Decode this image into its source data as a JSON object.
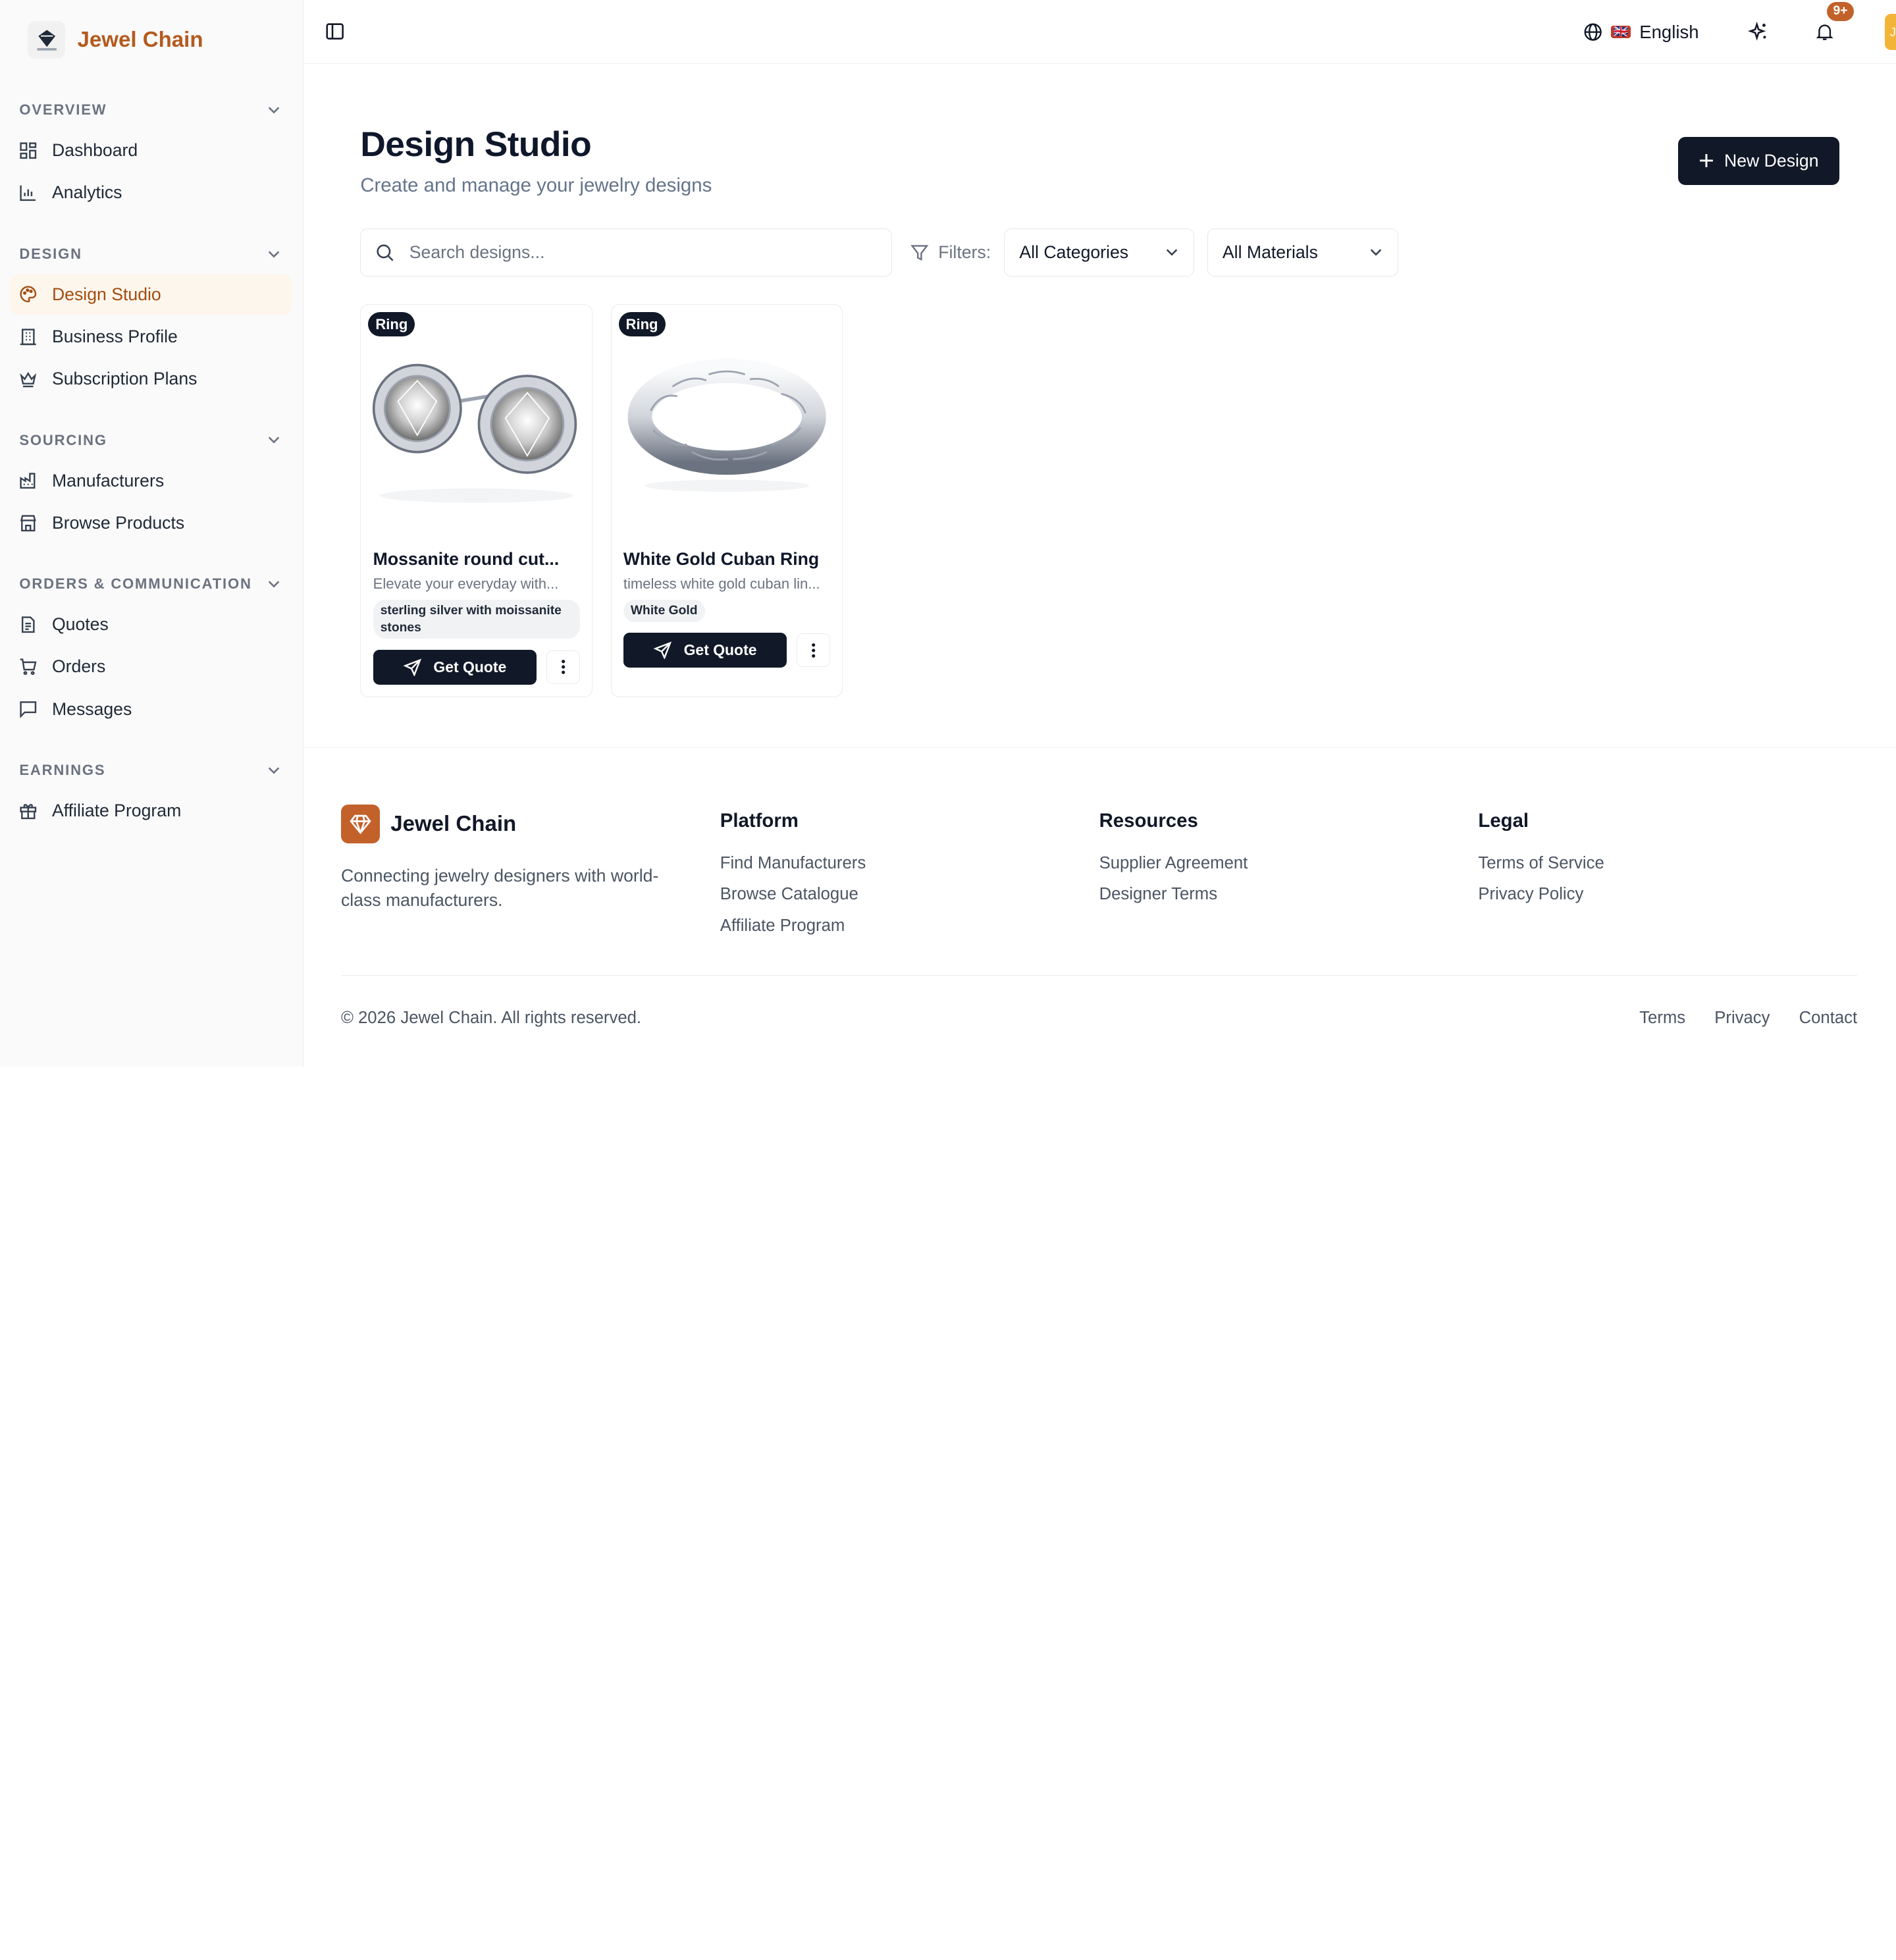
{
  "brand": {
    "name": "Jewel Chain"
  },
  "sidebar": {
    "sections": [
      {
        "title": "OVERVIEW",
        "items": [
          {
            "label": "Dashboard",
            "icon": "grid-icon"
          },
          {
            "label": "Analytics",
            "icon": "bar-chart-icon"
          }
        ]
      },
      {
        "title": "DESIGN",
        "items": [
          {
            "label": "Design Studio",
            "icon": "palette-icon",
            "active": true
          },
          {
            "label": "Business Profile",
            "icon": "building-icon"
          },
          {
            "label": "Subscription Plans",
            "icon": "crown-icon"
          }
        ]
      },
      {
        "title": "SOURCING",
        "items": [
          {
            "label": "Manufacturers",
            "icon": "factory-icon"
          },
          {
            "label": "Browse Products",
            "icon": "store-icon"
          }
        ]
      },
      {
        "title": "ORDERS & COMMUNICATION",
        "items": [
          {
            "label": "Quotes",
            "icon": "document-icon"
          },
          {
            "label": "Orders",
            "icon": "cart-icon"
          },
          {
            "label": "Messages",
            "icon": "message-icon"
          }
        ]
      },
      {
        "title": "EARNINGS",
        "items": [
          {
            "label": "Affiliate Program",
            "icon": "gift-icon"
          }
        ]
      }
    ]
  },
  "topbar": {
    "language": "English",
    "flag": "🇬🇧",
    "notifications": "9+",
    "avatar_initial": "J"
  },
  "main": {
    "title": "Design Studio",
    "subtitle": "Create and manage your jewelry designs",
    "new_button": "New Design",
    "search_placeholder": "Search designs...",
    "filters_label": "Filters:",
    "category_select": "All Categories",
    "material_select": "All Materials",
    "cards": [
      {
        "tag": "Ring",
        "title": "Mossanite round cut...",
        "description": "Elevate your everyday with...",
        "material": "sterling silver with moissanite stones",
        "action": "Get Quote"
      },
      {
        "tag": "Ring",
        "title": "White Gold Cuban Ring",
        "description": "timeless white gold cuban lin...",
        "material": "White Gold",
        "action": "Get Quote"
      }
    ]
  },
  "footer": {
    "brand": "Jewel Chain",
    "tagline": "Connecting jewelry designers with world-class manufacturers.",
    "columns": [
      {
        "title": "Platform",
        "links": [
          "Find Manufacturers",
          "Browse Catalogue",
          "Affiliate Program"
        ]
      },
      {
        "title": "Resources",
        "links": [
          "Supplier Agreement",
          "Designer Terms"
        ]
      },
      {
        "title": "Legal",
        "links": [
          "Terms of Service",
          "Privacy Policy"
        ]
      }
    ],
    "copyright": "© 2026 Jewel Chain. All rights reserved.",
    "bottom_links": [
      "Terms",
      "Privacy",
      "Contact"
    ]
  },
  "colors": {
    "accent": "#b45a1f",
    "dark": "#111827",
    "active_bg": "#fdf6ec",
    "badge": "#c2612a"
  }
}
